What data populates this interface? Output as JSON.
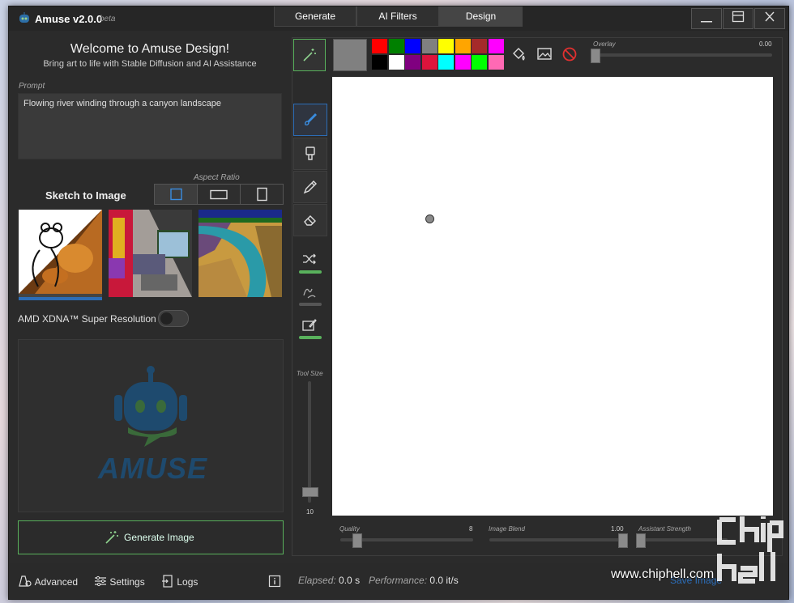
{
  "app": {
    "title": "Amuse v2.0.0",
    "beta": "beta"
  },
  "tabs": [
    {
      "label": "Generate",
      "active": false
    },
    {
      "label": "AI Filters",
      "active": false
    },
    {
      "label": "Design",
      "active": true
    }
  ],
  "window_controls": [
    "minimize-icon",
    "maximize-icon",
    "close-icon"
  ],
  "welcome": {
    "title": "Welcome to Amuse Design!",
    "subtitle": "Bring art to life with Stable Diffusion and AI Assistance"
  },
  "prompt": {
    "label": "Prompt",
    "value": "Flowing river winding through a canyon landscape"
  },
  "sketch": {
    "title": "Sketch to Image",
    "aspect_label": "Aspect Ratio",
    "selected_ratio": "square"
  },
  "super_res": {
    "label": "AMD XDNA™ Super Resolution",
    "enabled": false
  },
  "logo_text": "AMUSE",
  "generate_button": "Generate Image",
  "design": {
    "overlay_label": "Overlay",
    "overlay_value": "0.00",
    "tool_size_label": "Tool Size",
    "tool_size_value": "10",
    "palette": [
      "#ff0000",
      "#008000",
      "#0000ff",
      "#808080",
      "#ffff00",
      "#ffa500",
      "#a52a2a",
      "#ff00ff",
      "#000000",
      "#ffffff",
      "#800080",
      "#dc143c",
      "#00ffff",
      "#ff00ff",
      "#00ff00",
      "#ff69b4"
    ],
    "current_color": "#808080",
    "quality_label": "Quality",
    "quality_value": "8",
    "blend_label": "Image Blend",
    "blend_value": "1.00",
    "assistant_label": "Assistant Strength"
  },
  "status": {
    "advanced": "Advanced",
    "settings": "Settings",
    "logs": "Logs",
    "elapsed_label": "Elapsed:",
    "elapsed_value": "0.0 s",
    "perf_label": "Performance:",
    "perf_value": "0.0 it/s",
    "save": "Save Image"
  },
  "watermark": "www.chiphell.com",
  "colors": {
    "accent_green": "#59b15c",
    "accent_blue": "#2c6db7"
  }
}
